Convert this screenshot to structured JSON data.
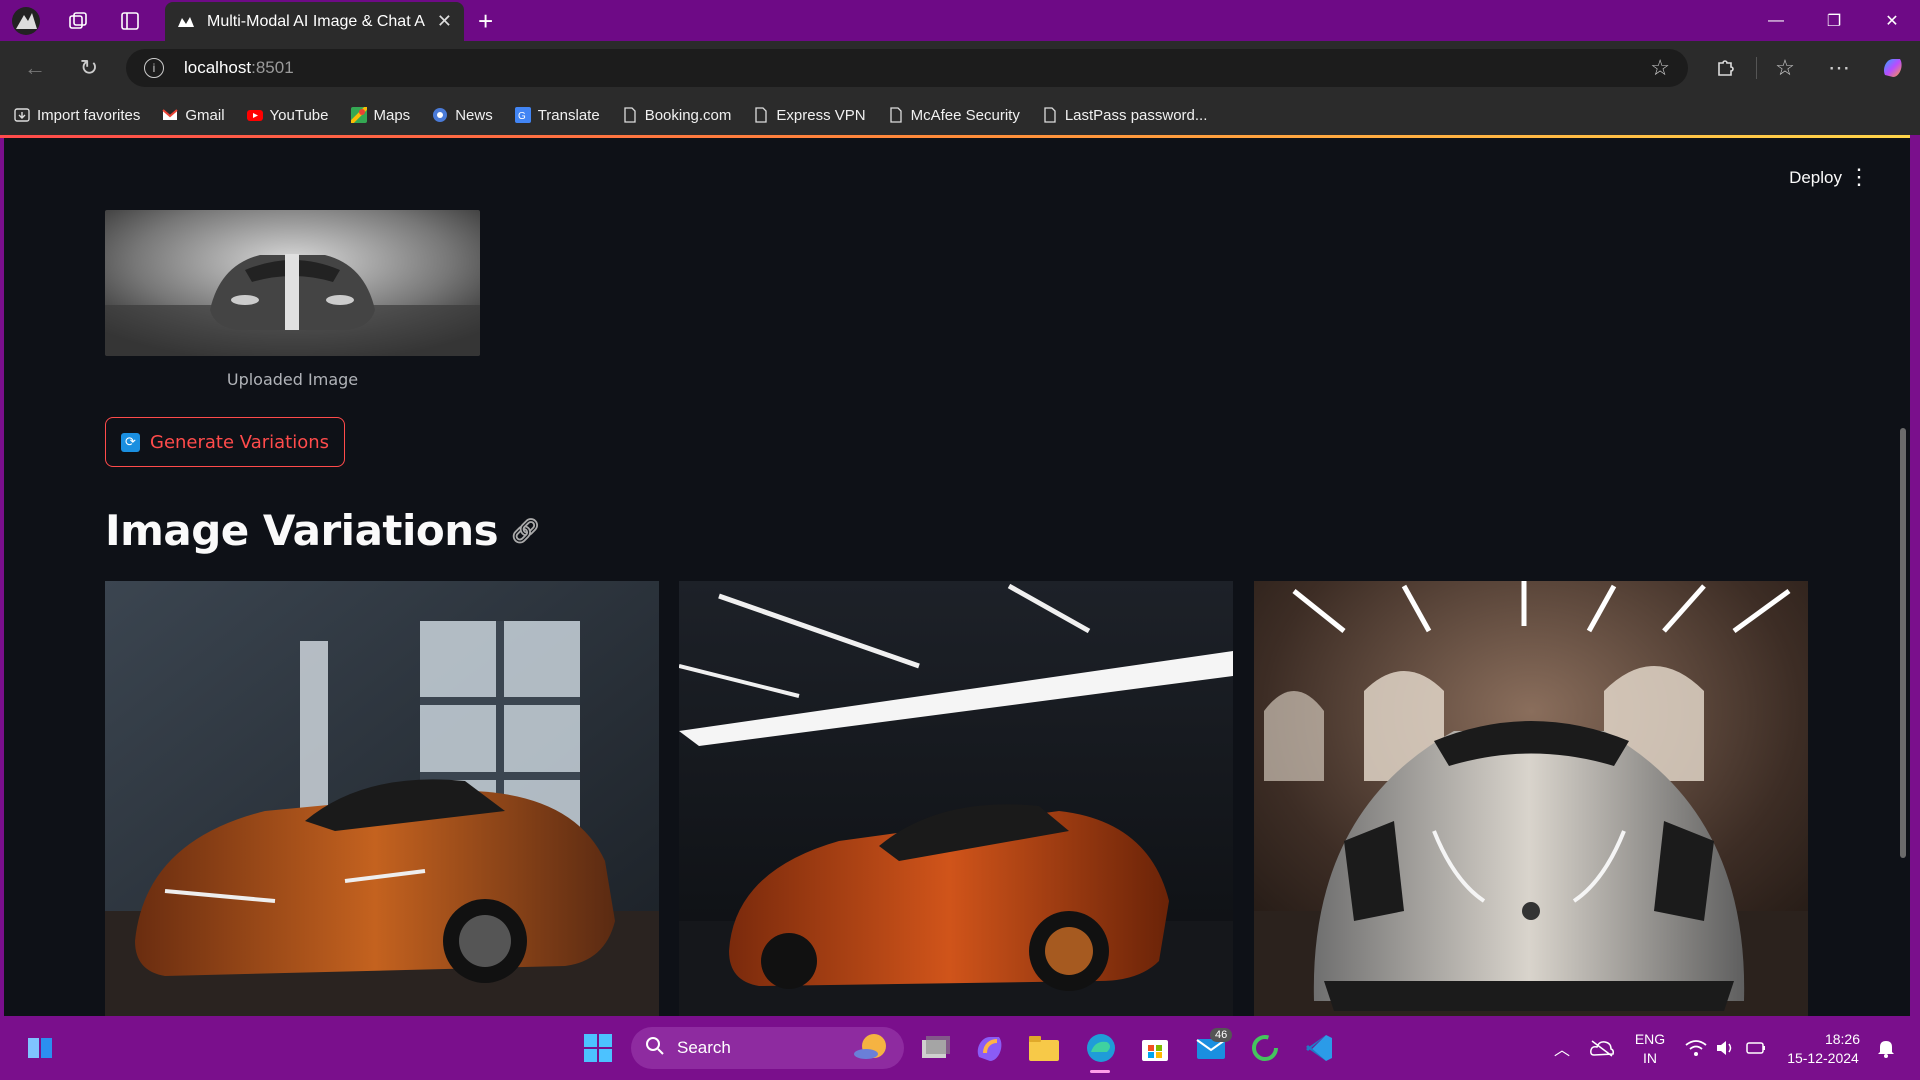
{
  "browser": {
    "tab_title": "Multi-Modal AI Image & Chat Ass",
    "url_host": "localhost",
    "url_port": ":8501",
    "bookmarks": [
      {
        "label": "Import favorites",
        "icon": "import-icon"
      },
      {
        "label": "Gmail",
        "icon": "gmail-icon"
      },
      {
        "label": "YouTube",
        "icon": "youtube-icon"
      },
      {
        "label": "Maps",
        "icon": "maps-icon"
      },
      {
        "label": "News",
        "icon": "news-icon"
      },
      {
        "label": "Translate",
        "icon": "translate-icon"
      },
      {
        "label": "Booking.com",
        "icon": "page-icon"
      },
      {
        "label": "Express VPN",
        "icon": "page-icon"
      },
      {
        "label": "McAfee Security",
        "icon": "page-icon"
      },
      {
        "label": "LastPass password...",
        "icon": "page-icon"
      }
    ]
  },
  "app": {
    "deploy_label": "Deploy",
    "uploaded_caption": "Uploaded Image",
    "generate_button": "Generate Variations",
    "section_title": "Image Variations",
    "accent_color": "#ff4b4b",
    "background_color": "#0e1117"
  },
  "taskbar": {
    "search_label": "Search",
    "mail_badge": "46",
    "lang_top": "ENG",
    "lang_bottom": "IN",
    "time": "18:26",
    "date": "15-12-2024"
  }
}
